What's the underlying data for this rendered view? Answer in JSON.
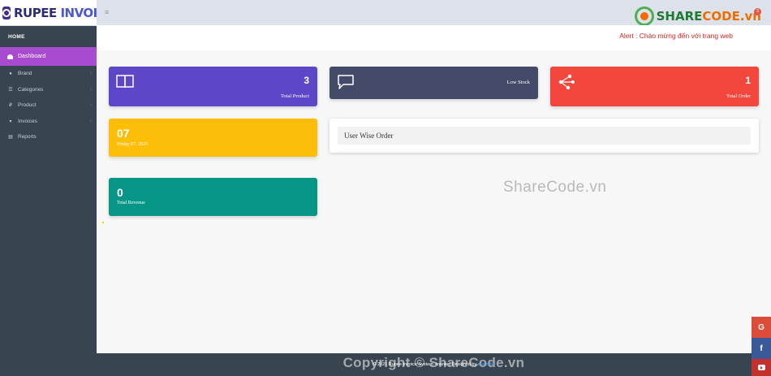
{
  "app": {
    "logo_part1": "RUPEE ",
    "logo_part2": "INVOICE"
  },
  "sidebar": {
    "section": "HOME",
    "active": {
      "label": "Dashboard",
      "icon": "dashboard-icon"
    },
    "items": [
      {
        "label": "Brand",
        "icon": "apple-icon"
      },
      {
        "label": "Categories",
        "icon": "list-icon"
      },
      {
        "label": "Product",
        "icon": "rupee-icon"
      },
      {
        "label": "Invoices",
        "icon": "cart-icon"
      },
      {
        "label": "Reports",
        "icon": "print-icon"
      }
    ]
  },
  "topbar": {
    "menu_icon": "≡",
    "brand_part1": "SHARE",
    "brand_part2": "CODE.vn",
    "badge": "3"
  },
  "alert": {
    "text": "Alert : Chào mừng đến với trang web"
  },
  "cards": {
    "total_product": {
      "value": "3",
      "label": "Total Product"
    },
    "low_stock": {
      "label": "Low Stock"
    },
    "total_order": {
      "value": "1",
      "label": "Total Order"
    },
    "date": {
      "day": "07",
      "full": "Friday 07, 2025"
    },
    "total_revenue": {
      "value": "0",
      "label": "Total Revenue"
    }
  },
  "panel": {
    "title": "User Wise Order"
  },
  "watermark": "ShareCode.vn",
  "footer": {
    "copyright": "Copyright © ShareCode.vn",
    "credit": "© 2021 Rupee Invoice System -toanle | Designed by ",
    "credit_link": "example"
  },
  "social": {
    "google": "G",
    "facebook": "f"
  },
  "colors": {
    "sidebar": "#384450",
    "active": "#a94bd1",
    "product": "#5d46c7",
    "stock": "#434b69",
    "order": "#f3463c",
    "date": "#fcbe08",
    "revenue": "#079685"
  }
}
